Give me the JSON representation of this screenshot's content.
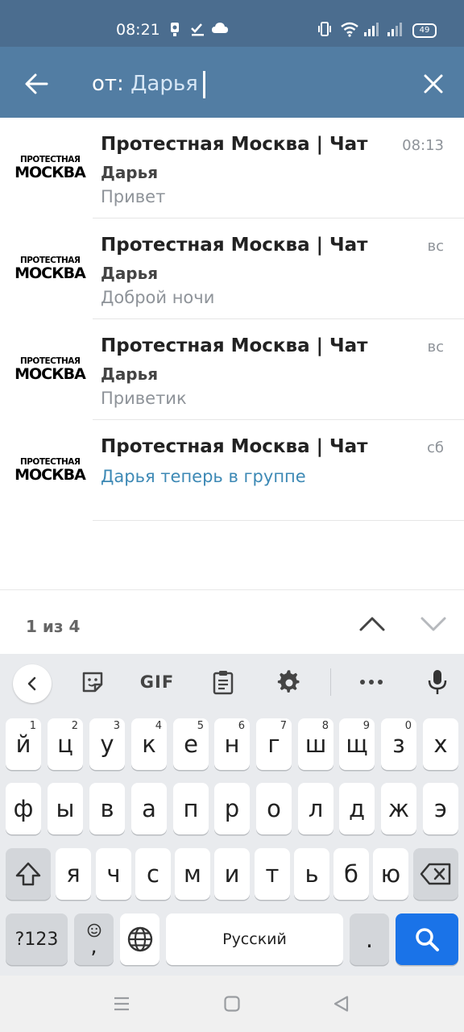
{
  "status_bar": {
    "time": "08:21",
    "battery": "49"
  },
  "search": {
    "prefix": "от: ",
    "value": "Дарья"
  },
  "results": [
    {
      "chat": "Протестная Москва | Чат",
      "time": "08:13",
      "sender": "Дарья",
      "message": "Привет"
    },
    {
      "chat": "Протестная Москва | Чат",
      "time": "вс",
      "sender": "Дарья",
      "message": "Доброй ночи"
    },
    {
      "chat": "Протестная Москва | Чат",
      "time": "вс",
      "sender": "Дарья",
      "message": "Приветик"
    },
    {
      "chat": "Протестная Москва | Чат",
      "time": "сб",
      "service_message": "Дарья теперь в группе"
    }
  ],
  "avatar_logo": {
    "line1": "ПРОТЕСТНАЯ",
    "line2": "МОСКВА"
  },
  "navigation": {
    "counter": "1 из 4"
  },
  "keyboard": {
    "toolbar": {
      "gif_label": "GIF"
    },
    "row1": [
      {
        "key": "й",
        "hint": "1"
      },
      {
        "key": "ц",
        "hint": "2"
      },
      {
        "key": "у",
        "hint": "3"
      },
      {
        "key": "к",
        "hint": "4"
      },
      {
        "key": "е",
        "hint": "5"
      },
      {
        "key": "н",
        "hint": "6"
      },
      {
        "key": "г",
        "hint": "7"
      },
      {
        "key": "ш",
        "hint": "8"
      },
      {
        "key": "щ",
        "hint": "9"
      },
      {
        "key": "з",
        "hint": "0"
      },
      {
        "key": "х",
        "hint": ""
      }
    ],
    "row2": [
      "ф",
      "ы",
      "в",
      "а",
      "п",
      "р",
      "о",
      "л",
      "д",
      "ж",
      "э"
    ],
    "row3": [
      "я",
      "ч",
      "с",
      "м",
      "и",
      "т",
      "ь",
      "б",
      "ю"
    ],
    "sym_label": "?123",
    "emoji_comma": ",",
    "space_label": "Русский",
    "period": "."
  }
}
